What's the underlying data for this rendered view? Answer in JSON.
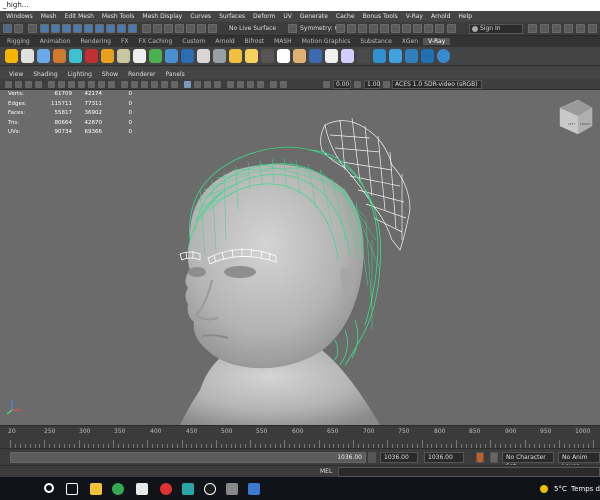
{
  "window": {
    "title": "_high..."
  },
  "menu": [
    "Windows",
    "Mesh",
    "Edit Mesh",
    "Mesh Tools",
    "Mesh Display",
    "Curves",
    "Surfaces",
    "Deform",
    "UV",
    "Generate",
    "Cache",
    "Bonus Tools",
    "V-Ray",
    "Arnold",
    "Help"
  ],
  "status_line": {
    "live_surface": "No Live Surface",
    "symmetry": "Symmetry: Off",
    "sign_in": "Sign In"
  },
  "shelf_tabs": [
    "Rigging",
    "Animation",
    "Rendering",
    "FX",
    "FX Caching",
    "Custom",
    "Arnold",
    "Bifrost",
    "MASH",
    "Motion Graphics",
    "Substance",
    "XGen",
    "V-Ray"
  ],
  "active_shelf_tab": "V-Ray",
  "panel_menu": [
    "View",
    "Shading",
    "Lighting",
    "Show",
    "Renderer",
    "Panels"
  ],
  "panel_toolbar": {
    "exposure": "0.00",
    "gamma": "1.00",
    "color_space": "ACES 1.0 SDR-video (sRGB)"
  },
  "hud": {
    "rows": [
      {
        "label": "Verts:",
        "v1": "61709",
        "v2": "42174",
        "v3": "0"
      },
      {
        "label": "Edges:",
        "v1": "115711",
        "v2": "77311",
        "v3": "0"
      },
      {
        "label": "Faces:",
        "v1": "55817",
        "v2": "36902",
        "v3": "0"
      },
      {
        "label": "Tris:",
        "v1": "80664",
        "v2": "42870",
        "v3": "0"
      },
      {
        "label": "UVs:",
        "v1": "90734",
        "v2": "69366",
        "v3": "0"
      }
    ]
  },
  "viewcube": {
    "left": "LEFT",
    "front": "FRONT"
  },
  "time_slider": {
    "labels": [
      "20",
      "250",
      "300",
      "350",
      "400",
      "450",
      "500",
      "550",
      "600",
      "650",
      "700",
      "750",
      "800",
      "850",
      "900",
      "950",
      "1000"
    ]
  },
  "range_slider": {
    "range_end": "1036.00",
    "end_time": "1036.00",
    "anim_end": "1036.00",
    "character_set": "No Character Set",
    "anim_layer": "No Anim Layer"
  },
  "command_line": {
    "language": "MEL"
  },
  "taskbar": {
    "temperature": "5°C",
    "weather": "Temps dég"
  },
  "colors": {
    "hair_wire": "#3dd98f",
    "viewport_bg": "#6b6b6b",
    "skin": "#b8b8b8"
  }
}
